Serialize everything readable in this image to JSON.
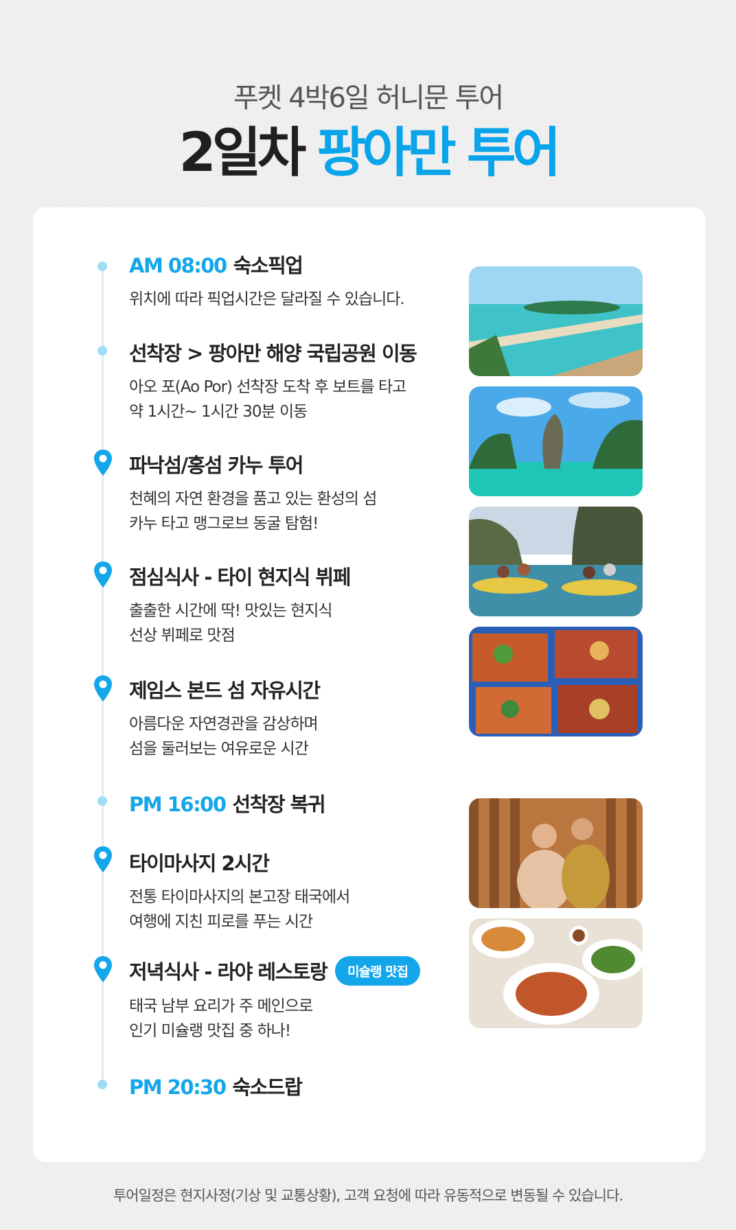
{
  "header": {
    "subtitle": "푸켓 4박6일 허니문 투어",
    "title_dark": "2일차",
    "title_blue": "팡아만 투어"
  },
  "colors": {
    "accent": "#14a6ea",
    "dot": "#9fdcf6",
    "text": "#222222"
  },
  "items": [
    {
      "time": "AM 08:00",
      "title": "숙소픽업",
      "marker": "dot",
      "desc": [
        "위치에 따라 픽업시간은 달라질 수 있습니다."
      ]
    },
    {
      "title": "선착장 > 팡아만 해양 국립공원 이동",
      "marker": "dot",
      "desc": [
        "아오 포(Ao Por) 선착장 도착 후 보트를 타고",
        "약 1시간~ 1시간 30분 이동"
      ]
    },
    {
      "title": "파낙섬/홍섬 카누 투어",
      "marker": "location-pin-icon",
      "desc": [
        "천혜의 자연 환경을 품고 있는 환성의 섬",
        "카누 타고 맹그로브 동굴 탐험!"
      ]
    },
    {
      "title": "점심식사 - 타이 현지식 뷔페",
      "marker": "location-pin-icon",
      "desc": [
        "출출한 시간에 딱! 맛있는 현지식",
        "선상 뷔페로 맛점"
      ]
    },
    {
      "title": "제임스 본드 섬 자유시간",
      "marker": "location-pin-icon",
      "desc": [
        "아름다운 자연경관을 감상하며",
        "섬을 둘러보는 여유로운 시간"
      ]
    },
    {
      "time": "PM 16:00",
      "title": "선착장 복귀",
      "marker": "dot",
      "desc": []
    },
    {
      "title": "타이마사지 2시간",
      "marker": "location-pin-icon",
      "desc": [
        "전통 타이마사지의 본고장 태국에서",
        "여행에 지친 피로를 푸는 시간"
      ]
    },
    {
      "title": "저녁식사 - 라야 레스토랑",
      "badge": "미슐랭 맛집",
      "marker": "location-pin-icon",
      "desc": [
        "태국 남부 요리가 주 메인으로",
        "인기 미슐랭 맛집 중 하나!"
      ]
    },
    {
      "time": "PM 20:30",
      "title": "숙소드랍",
      "marker": "dot",
      "desc": []
    }
  ],
  "footer": "투어일정은 현지사정(기상 및 교통상황), 고객 요청에 따라 유동적으로 변동될 수 있습니다."
}
